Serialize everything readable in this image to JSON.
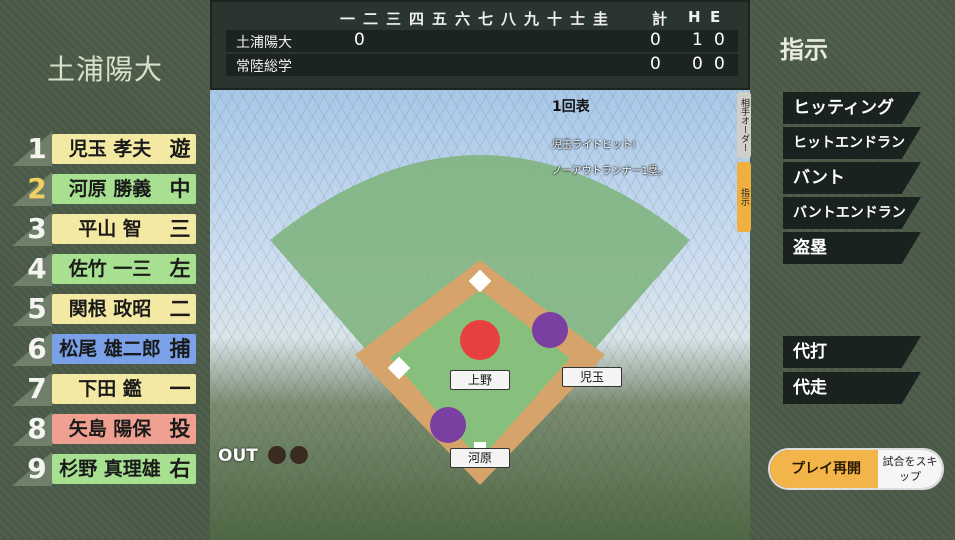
{
  "team": "土浦陽大",
  "lineup": [
    {
      "num": "1",
      "name": "児玉 孝夫",
      "pos": "遊",
      "color": "yellow"
    },
    {
      "num": "2",
      "name": "河原 勝義",
      "pos": "中",
      "color": "green",
      "highlight": true
    },
    {
      "num": "3",
      "name": "平山 智",
      "pos": "三",
      "color": "yellow"
    },
    {
      "num": "4",
      "name": "佐竹 一三",
      "pos": "左",
      "color": "green"
    },
    {
      "num": "5",
      "name": "関根 政昭",
      "pos": "二",
      "color": "yellow"
    },
    {
      "num": "6",
      "name": "松尾 雄二郎",
      "pos": "捕",
      "color": "blue"
    },
    {
      "num": "7",
      "name": "下田 鑑",
      "pos": "一",
      "color": "yellow"
    },
    {
      "num": "8",
      "name": "矢島 陽保",
      "pos": "投",
      "color": "red"
    },
    {
      "num": "9",
      "name": "杉野 真理雄",
      "pos": "右",
      "color": "green"
    }
  ],
  "scoreboard": {
    "innings": [
      "一",
      "二",
      "三",
      "四",
      "五",
      "六",
      "七",
      "八",
      "九",
      "十",
      "士",
      "圭"
    ],
    "total_label": "計",
    "h_label": "H",
    "e_label": "E",
    "rows": [
      {
        "team": "土浦陽大",
        "innings": "0",
        "total": "0",
        "h": "1",
        "e": "0"
      },
      {
        "team": "常陸総学",
        "innings": "",
        "total": "0",
        "h": "0",
        "e": "0"
      }
    ]
  },
  "field": {
    "inning": "1回表",
    "messages": [
      "児玉ライトヒット!",
      "ノーアウトランナー1塁。"
    ],
    "out_label": "OUT",
    "outs": 0,
    "players": [
      "上野",
      "児玉",
      "河原"
    ]
  },
  "side_tabs": [
    "相手オーダー",
    "指示"
  ],
  "directives": {
    "title": "指示",
    "commands": [
      "ヒッティング",
      "ヒットエンドラン",
      "バント",
      "バントエンドラン",
      "盗塁"
    ],
    "subs": [
      "代打",
      "代走"
    ]
  },
  "buttons": {
    "resume": "プレイ再開",
    "skip": "試合をスキップ"
  }
}
